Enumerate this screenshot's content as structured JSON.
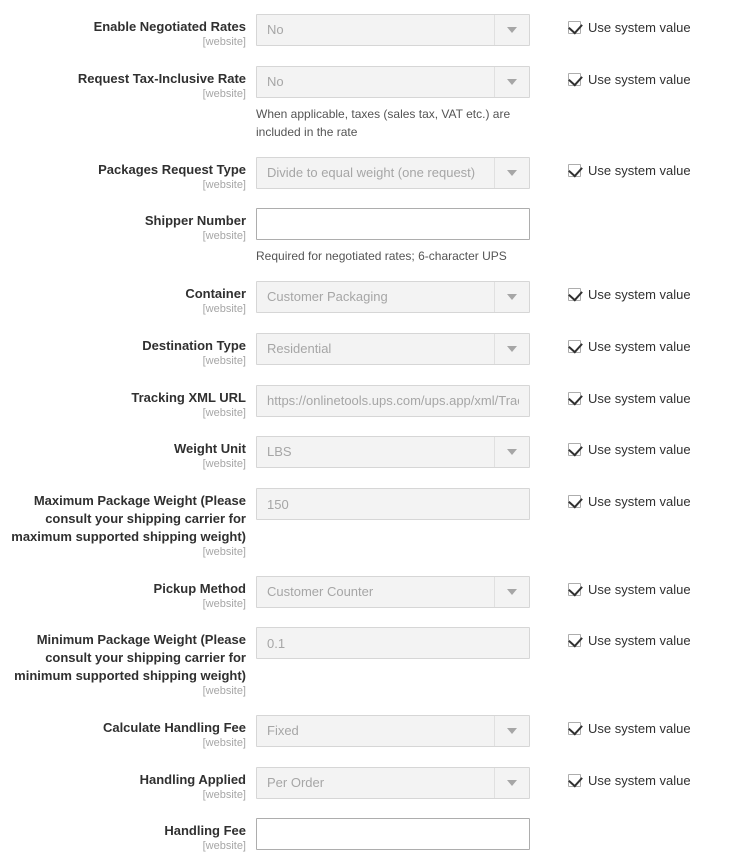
{
  "form": {
    "scope_label": "[website]",
    "system_value_label": "Use system value",
    "fields": [
      {
        "id": "enable-negotiated-rates",
        "label": "Enable Negotiated Rates",
        "scope": "[website]",
        "control": "select",
        "value": "No",
        "disabled": true,
        "note": "",
        "system_value": true,
        "system_value_label": "Use system value"
      },
      {
        "id": "request-tax-inclusive-rate",
        "label": "Request Tax-Inclusive Rate",
        "scope": "[website]",
        "control": "select",
        "value": "No",
        "disabled": true,
        "note": "When applicable, taxes (sales tax, VAT etc.) are included in the rate",
        "system_value": true,
        "system_value_label": "Use system value"
      },
      {
        "id": "packages-request-type",
        "label": "Packages Request Type",
        "scope": "[website]",
        "control": "select",
        "value": "Divide to equal weight (one request)",
        "disabled": true,
        "note": "",
        "system_value": true,
        "system_value_label": "Use system value"
      },
      {
        "id": "shipper-number",
        "label": "Shipper Number",
        "scope": "[website]",
        "control": "text",
        "value": "",
        "disabled": false,
        "note": "Required for negotiated rates; 6-character UPS",
        "system_value": false,
        "system_value_label": ""
      },
      {
        "id": "container",
        "label": "Container",
        "scope": "[website]",
        "control": "select",
        "value": "Customer Packaging",
        "disabled": true,
        "note": "",
        "system_value": true,
        "system_value_label": "Use system value"
      },
      {
        "id": "destination-type",
        "label": "Destination Type",
        "scope": "[website]",
        "control": "select",
        "value": "Residential",
        "disabled": true,
        "note": "",
        "system_value": true,
        "system_value_label": "Use system value"
      },
      {
        "id": "tracking-xml-url",
        "label": "Tracking XML URL",
        "scope": "[website]",
        "control": "text",
        "value": "https://onlinetools.ups.com/ups.app/xml/Track",
        "disabled": true,
        "note": "",
        "system_value": true,
        "system_value_label": "Use system value"
      },
      {
        "id": "weight-unit",
        "label": "Weight Unit",
        "scope": "[website]",
        "control": "select",
        "value": "LBS",
        "disabled": true,
        "note": "",
        "system_value": true,
        "system_value_label": "Use system value"
      },
      {
        "id": "maximum-package-weight",
        "label": "Maximum Package Weight (Please consult your shipping carrier for maximum supported shipping weight)",
        "scope": "[website]",
        "control": "text",
        "value": "150",
        "disabled": true,
        "note": "",
        "system_value": true,
        "system_value_label": "Use system value"
      },
      {
        "id": "pickup-method",
        "label": "Pickup Method",
        "scope": "[website]",
        "control": "select",
        "value": "Customer Counter",
        "disabled": true,
        "note": "",
        "system_value": true,
        "system_value_label": "Use system value"
      },
      {
        "id": "minimum-package-weight",
        "label": "Minimum Package Weight (Please consult your shipping carrier for minimum supported shipping weight)",
        "scope": "[website]",
        "control": "text",
        "value": "0.1",
        "disabled": true,
        "note": "",
        "system_value": true,
        "system_value_label": "Use system value"
      },
      {
        "id": "calculate-handling-fee",
        "label": "Calculate Handling Fee",
        "scope": "[website]",
        "control": "select",
        "value": "Fixed",
        "disabled": true,
        "note": "",
        "system_value": true,
        "system_value_label": "Use system value"
      },
      {
        "id": "handling-applied",
        "label": "Handling Applied",
        "scope": "[website]",
        "control": "select",
        "value": "Per Order",
        "disabled": true,
        "note": "",
        "system_value": true,
        "system_value_label": "Use system value"
      },
      {
        "id": "handling-fee",
        "label": "Handling Fee",
        "scope": "[website]",
        "control": "text",
        "value": "",
        "disabled": false,
        "note": "",
        "system_value": false,
        "system_value_label": ""
      }
    ]
  },
  "colors": {
    "label_text": "#303030",
    "scope_text": "#a6a6a6",
    "disabled_bg": "#f3f3f3",
    "disabled_border": "#d6d6d6",
    "disabled_text": "#a6a6a6",
    "input_border": "#adadad",
    "note_text": "#545454",
    "page_bg": "#ffffff"
  }
}
